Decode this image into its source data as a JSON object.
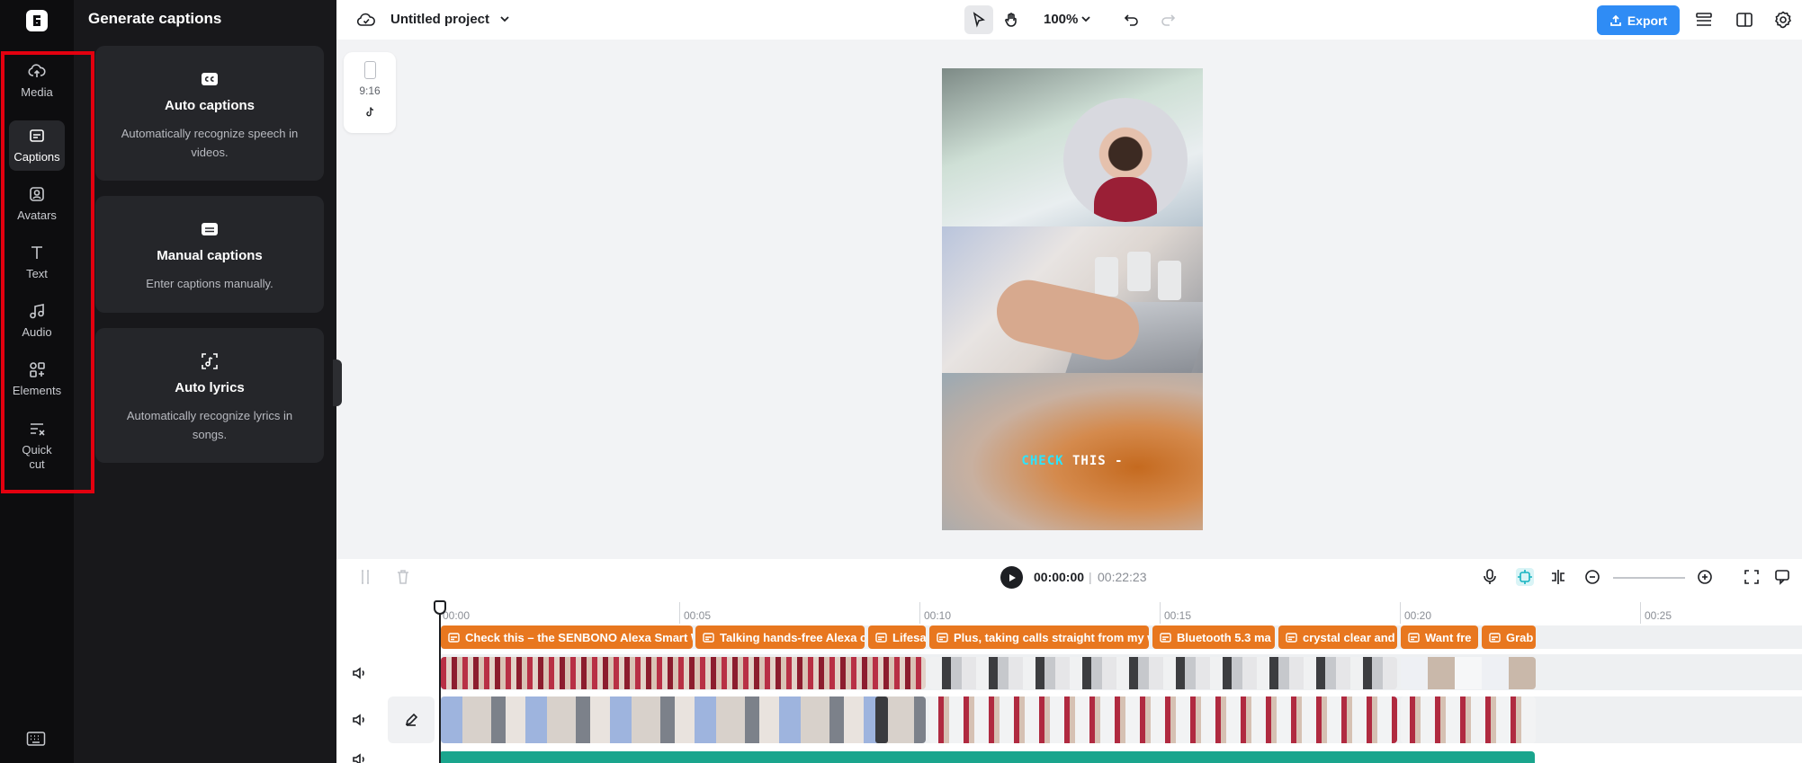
{
  "rail": {
    "items": [
      {
        "label": "Media",
        "icon": "cloud-upload-icon"
      },
      {
        "label": "Captions",
        "icon": "captions-icon"
      },
      {
        "label": "Avatars",
        "icon": "avatar-icon"
      },
      {
        "label": "Text",
        "icon": "text-icon"
      },
      {
        "label": "Audio",
        "icon": "music-note-icon"
      },
      {
        "label": "Elements",
        "icon": "elements-icon"
      },
      {
        "label": "Quick cut",
        "icon": "quick-cut-icon"
      }
    ],
    "active": "Captions",
    "highlight_color": "#e3000f"
  },
  "panel": {
    "title": "Generate captions",
    "cards": [
      {
        "title": "Auto captions",
        "desc": "Automatically recognize speech in videos.",
        "icon": "cc-icon"
      },
      {
        "title": "Manual captions",
        "desc": "Enter captions manually.",
        "icon": "subtitle-icon"
      },
      {
        "title": "Auto lyrics",
        "desc": "Automatically recognize lyrics in songs.",
        "icon": "lyrics-icon"
      }
    ]
  },
  "topbar": {
    "project_name": "Untitled project",
    "zoom": "100%",
    "export_label": "Export",
    "accent": "#2f8cf5"
  },
  "ratio": {
    "label": "9:16"
  },
  "preview": {
    "caption_highlight": "CHECK",
    "caption_rest": "THIS -",
    "caption_highlight_color": "#2be5ff"
  },
  "playback": {
    "current": "00:00:00",
    "separator": "|",
    "total": "00:22:23"
  },
  "timeline": {
    "ruler": [
      "00:00",
      "00:05",
      "00:10",
      "00:15",
      "00:20",
      "00:25"
    ],
    "caption_clips": [
      "Check this – the SENBONO Alexa Smart W",
      "Talking hands-free Alexa c",
      "Lifesa",
      "Plus, taking calls straight from my w",
      "Bluetooth 5.3 ma",
      "crystal clear and s",
      "Want fre",
      "Grab"
    ],
    "caption_color": "#e8771f",
    "audio_color": "#1aa58d"
  }
}
